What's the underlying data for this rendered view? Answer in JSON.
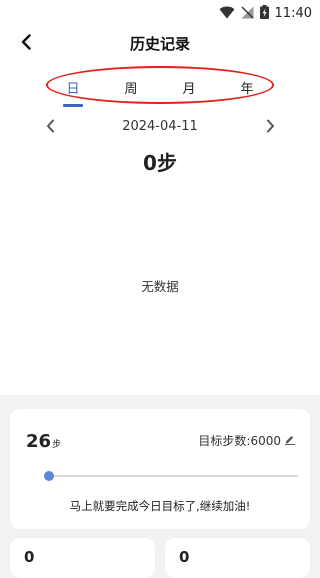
{
  "status_bar": {
    "time": "11:40",
    "icons": [
      "wifi-icon",
      "no-signal-icon",
      "battery-charging-icon"
    ]
  },
  "header": {
    "title": "历史记录",
    "back_icon": "chevron-left-icon"
  },
  "tabs": [
    {
      "label": "日",
      "active": true
    },
    {
      "label": "周",
      "active": false
    },
    {
      "label": "月",
      "active": false
    },
    {
      "label": "年",
      "active": false
    }
  ],
  "date_nav": {
    "date": "2024-04-11",
    "prev_icon": "chevron-left-icon",
    "next_icon": "chevron-right-icon"
  },
  "summary": {
    "steps": "0步"
  },
  "chart": {
    "empty_text": "无数据"
  },
  "goal_card": {
    "current_steps": "26",
    "unit": "步",
    "target_label": "目标步数:6000",
    "edit_icon": "pencil-icon",
    "progress_fraction": 0.004,
    "message": "马上就要完成今日目标了,继续加油!"
  },
  "stat_cards": [
    {
      "value": "0"
    },
    {
      "value": "0"
    }
  ],
  "colors": {
    "accent": "#3b62c4",
    "slider_knob": "#5b87d6",
    "highlight_oval": "#e2231a",
    "background": "#f2f2f2"
  }
}
